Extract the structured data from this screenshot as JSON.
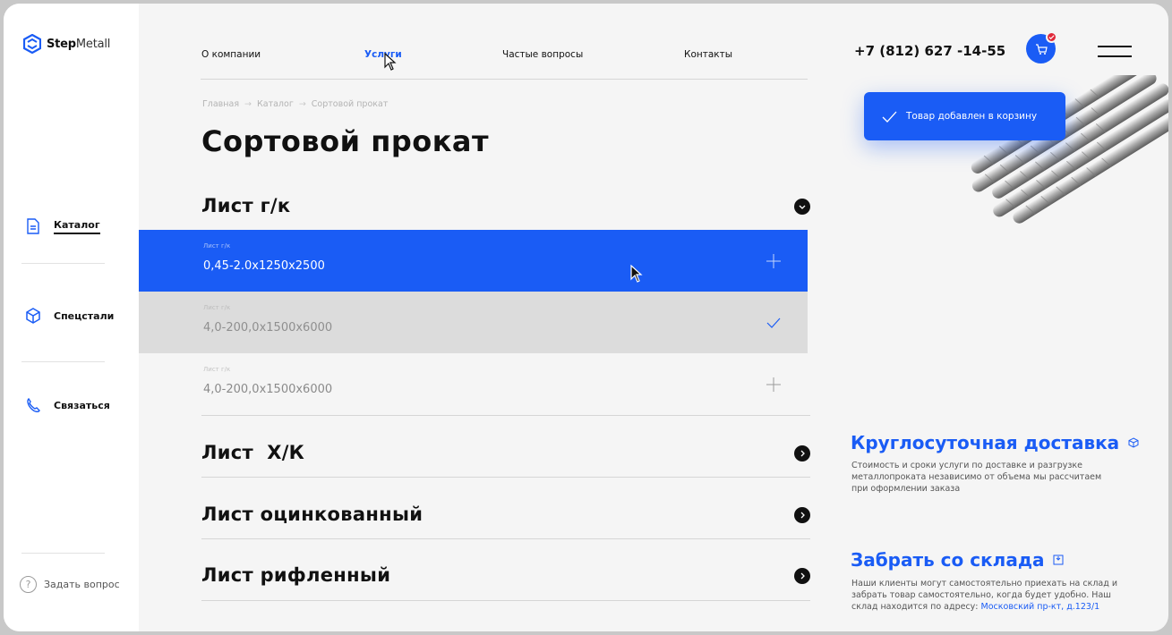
{
  "brand": {
    "bold": "Step",
    "light": "Metall"
  },
  "sidebar": {
    "items": [
      {
        "label": "Каталог",
        "icon": "document-icon"
      },
      {
        "label": "Спецстали",
        "icon": "cube-icon"
      },
      {
        "label": "Связаться",
        "icon": "phone-icon"
      }
    ],
    "ask": {
      "label": "Задать вопрос",
      "icon_glyph": "?"
    }
  },
  "nav": {
    "links": [
      "О компании",
      "Услуги",
      "Частые вопросы",
      "Контакты"
    ],
    "active": "Услуги",
    "phone": "+7 (812) 627 -14-55"
  },
  "breadcrumb": [
    "Главная",
    "Каталог",
    "Сортовой прокат"
  ],
  "breadcrumb_sep": "→",
  "page_title": "Сортовой прокат",
  "accordion": {
    "open_section": "Лист г/к",
    "rows": [
      {
        "small": "Лист г/к",
        "value": "0,45-2.0x1250x2500",
        "state": "selected"
      },
      {
        "small": "Лист г/к",
        "value": "4,0-200,0x1500x6000",
        "state": "added"
      },
      {
        "small": "Лист г/к",
        "value": "4,0-200,0x1500x6000",
        "state": "plain"
      }
    ],
    "sections": [
      "Лист  Х/К",
      "Лист оцинкованный",
      "Лист рифленный"
    ]
  },
  "toast": {
    "text": "Товар добавлен в корзину"
  },
  "info": {
    "delivery": {
      "title": "Круглосуточная доставка",
      "text": "Стоимость и сроки услуги по доставке и разгрузке металлопроката независимо от объема мы рассчитаем при оформлении заказа"
    },
    "pickup": {
      "title": "Забрать со склада",
      "text": "Наши клиенты могут самостоятельно приехать на склад и забрать товар самостоятельно, когда будет удобно. Наш склад находится по адресу:",
      "address": "Московский пр-кт, д.123/1"
    }
  },
  "colors": {
    "accent": "#1a5cf5",
    "badge": "#e0293a",
    "bg": "#f5f5f5"
  }
}
